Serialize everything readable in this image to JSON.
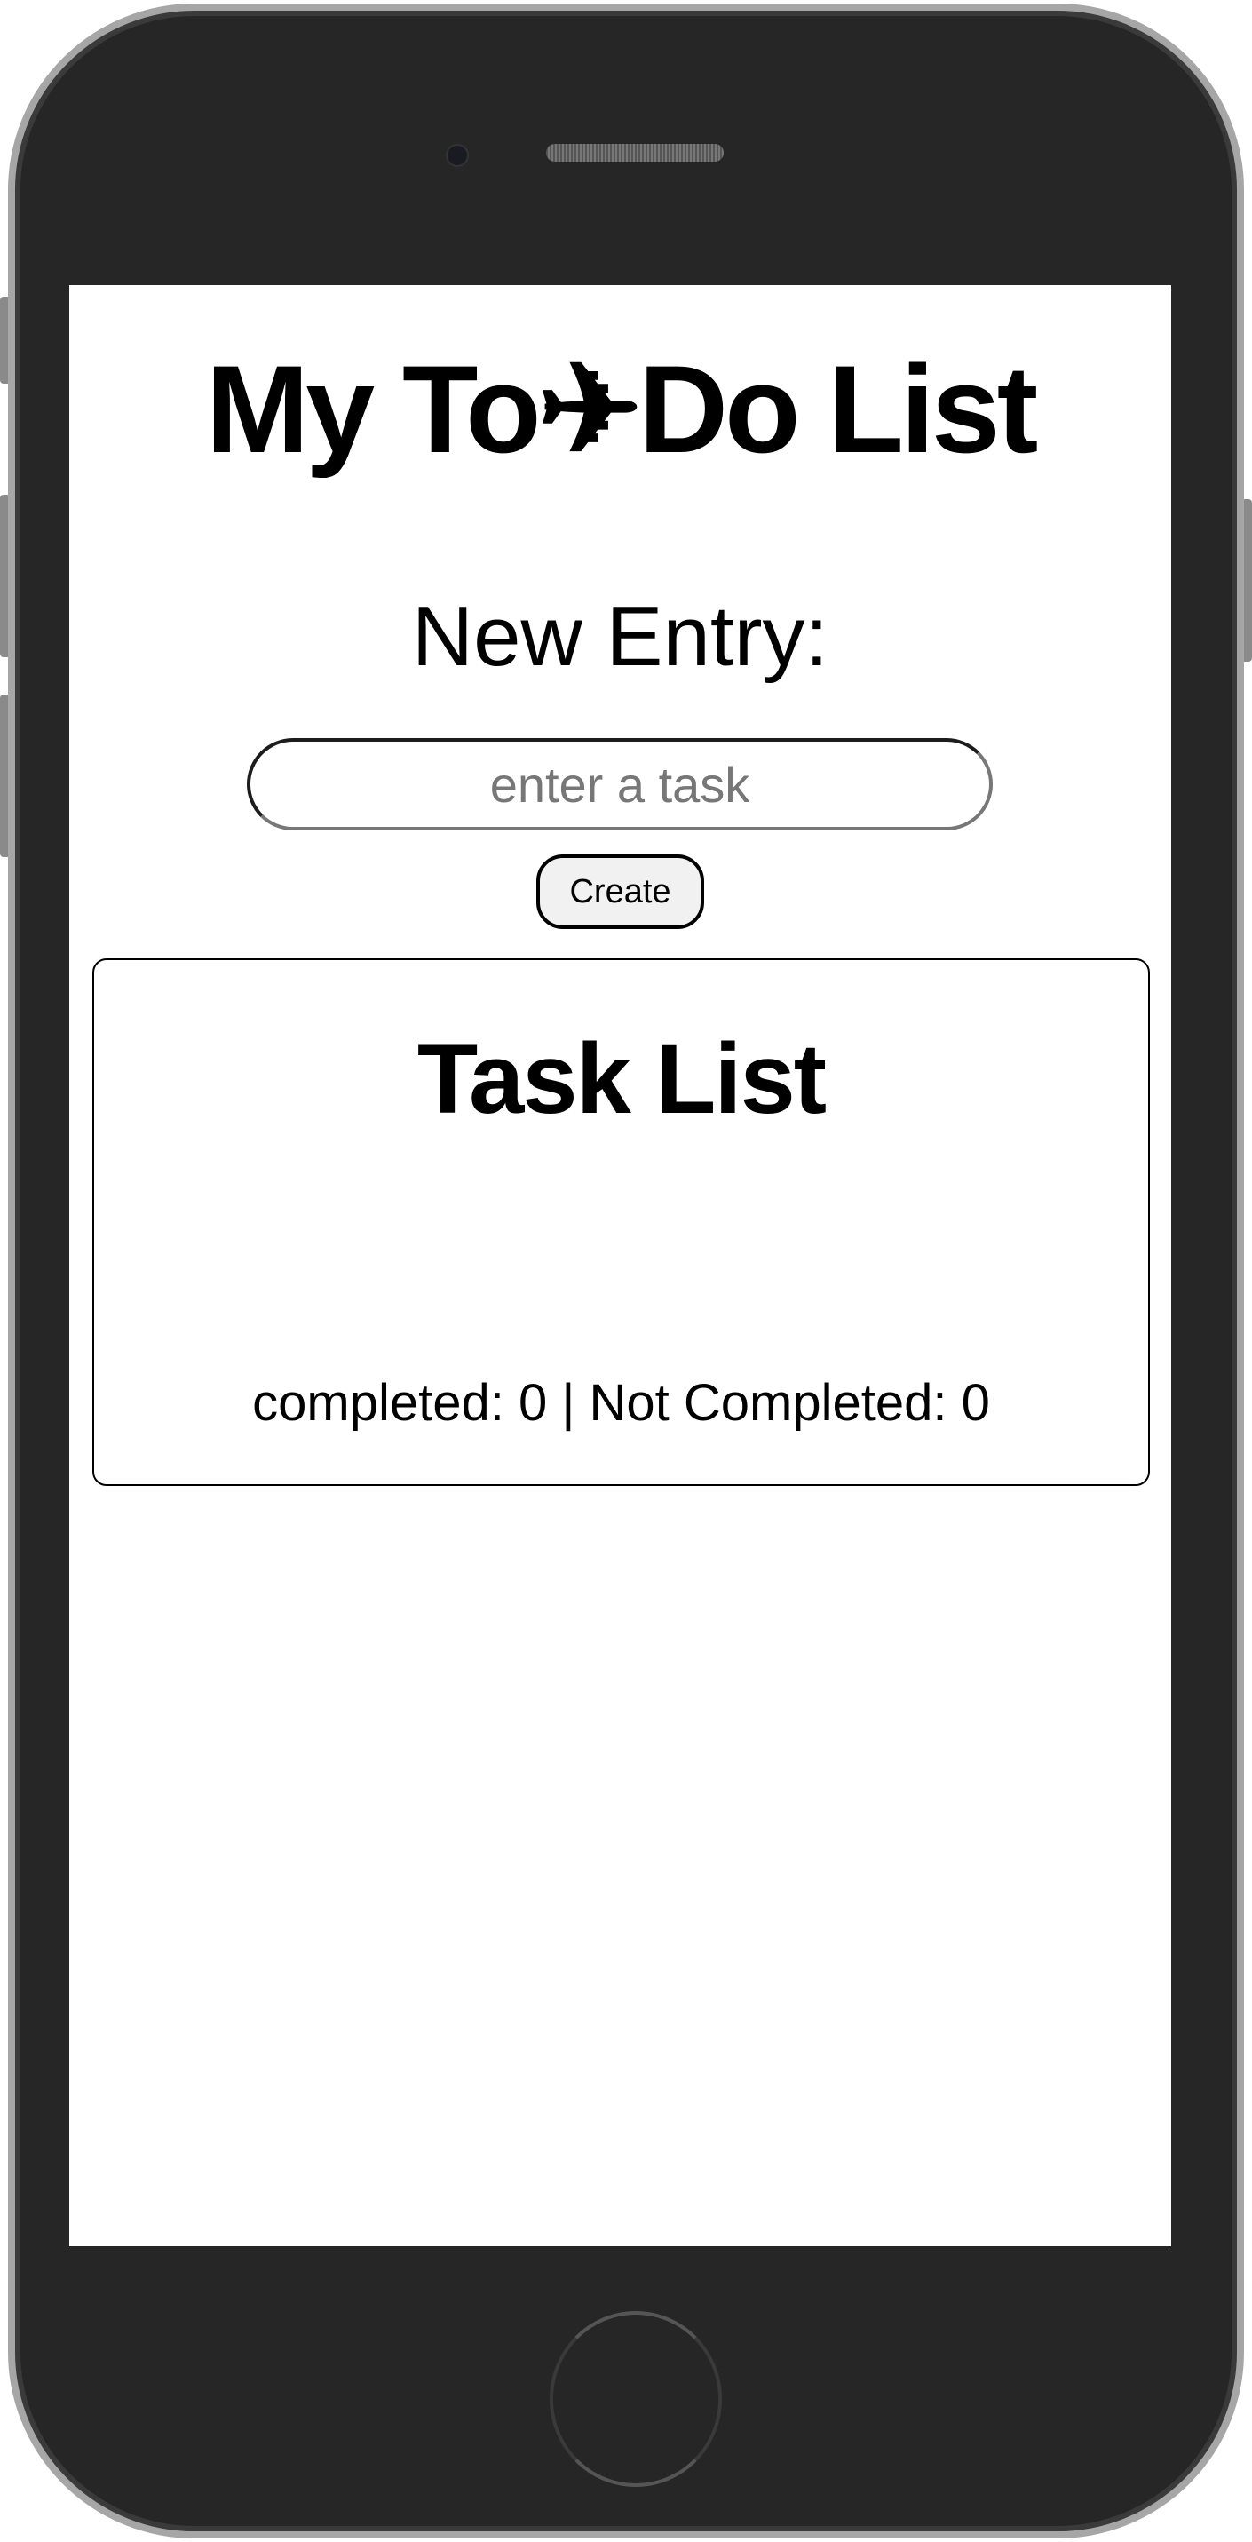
{
  "app": {
    "title": "My To✈Do List",
    "new_entry_label": "New Entry:",
    "input": {
      "value": "",
      "placeholder": "enter a task"
    },
    "create_label": "Create",
    "task_list": {
      "title": "Task List",
      "status": "completed: 0 | Not Completed: 0"
    }
  }
}
